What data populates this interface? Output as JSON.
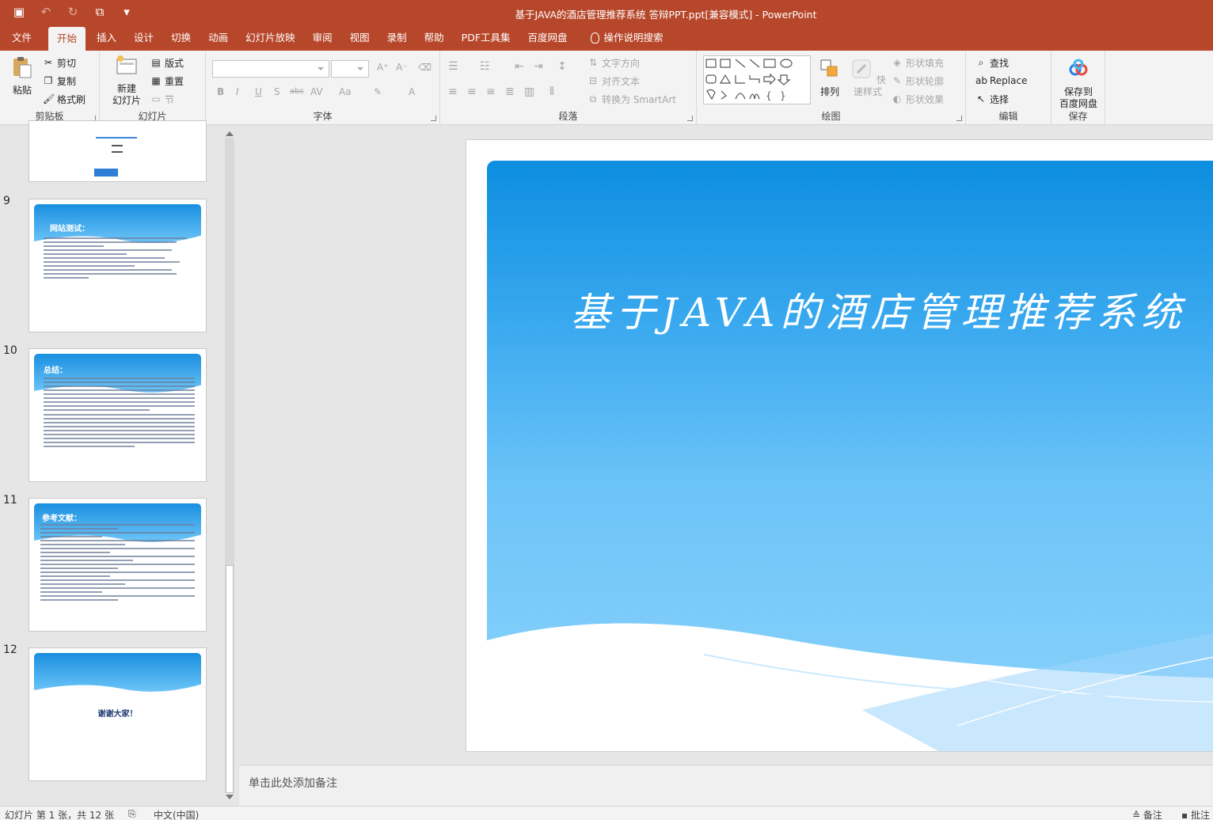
{
  "window": {
    "title": "基于JAVA的酒店管理推荐系统 答辩PPT.ppt[兼容模式]  -  PowerPoint"
  },
  "qat": {
    "save": "save-icon",
    "undo": "undo-icon",
    "redo": "redo-icon",
    "start": "slideshow-icon",
    "more": "customize-icon"
  },
  "tabs": [
    "文件",
    "开始",
    "插入",
    "设计",
    "切换",
    "动画",
    "幻灯片放映",
    "审阅",
    "视图",
    "录制",
    "帮助",
    "PDF工具集",
    "百度网盘"
  ],
  "search_label": "操作说明搜索",
  "ribbon": {
    "clipboard": {
      "paste": "粘贴",
      "cut": "剪切",
      "copy": "复制",
      "painter": "格式刷",
      "label": "剪贴板"
    },
    "slides": {
      "new_slide_1": "新建",
      "new_slide_2": "幻灯片",
      "layout": "版式",
      "reset": "重置",
      "section": "节",
      "label": "幻灯片"
    },
    "font": {
      "label": "字体",
      "buttons": [
        "B",
        "I",
        "U",
        "S",
        "abc",
        "AV",
        "Aa",
        "A"
      ]
    },
    "paragraph": {
      "text_direction": "文字方向",
      "align_text": "对齐文本",
      "smartart": "转换为 SmartArt",
      "label": "段落"
    },
    "drawing": {
      "arrange": "排列",
      "quick_styles": "快速样式",
      "fill": "形状填充",
      "outline": "形状轮廓",
      "effects": "形状效果",
      "label": "绘图"
    },
    "editing": {
      "find": "查找",
      "replace": "Replace",
      "select": "选择",
      "label": "编辑"
    },
    "save": {
      "line1": "保存到",
      "line2": "百度网盘",
      "label": "保存"
    }
  },
  "thumbnails": [
    {
      "num": "",
      "title": ""
    },
    {
      "num": "9",
      "title": "网站测试："
    },
    {
      "num": "10",
      "title": "总结："
    },
    {
      "num": "11",
      "title": "参考文献："
    },
    {
      "num": "12",
      "title": "谢谢大家！"
    }
  ],
  "slide": {
    "title": "基于JAVA的酒店管理推荐系统"
  },
  "notes_placeholder": "单击此处添加备注",
  "status": {
    "slide_info": "幻灯片 第 1 张，共 12 张",
    "language": "中文(中国)",
    "notes": "备注",
    "comments": "批注"
  },
  "colors": {
    "accent": "#b7472a",
    "slide_blue": "#0d8ee0"
  }
}
